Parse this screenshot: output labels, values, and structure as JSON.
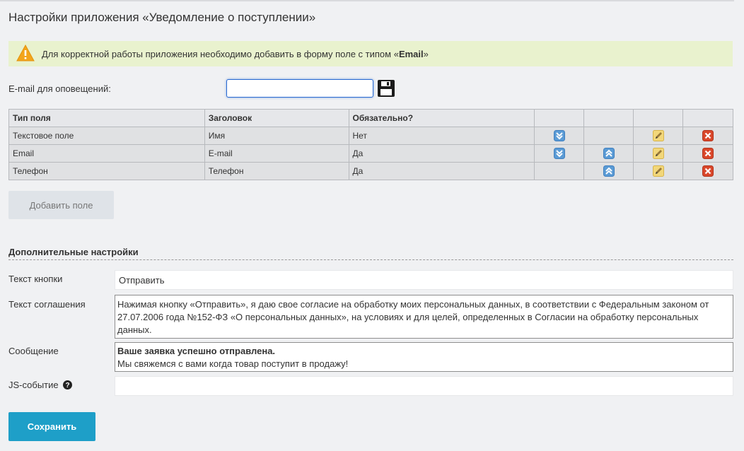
{
  "page": {
    "title": "Настройки приложения «Уведомление о поступлении»"
  },
  "warning": {
    "text": "Для корректной работы приложения необходимо добавить в форму поле с типом «",
    "bold": "Email",
    "suffix": "»"
  },
  "email_notify": {
    "label": "E-mail для оповещений:",
    "value": ""
  },
  "fields_table": {
    "headers": [
      "Тип поля",
      "Заголовок",
      "Обязательно?"
    ],
    "rows": [
      {
        "type": "Текстовое поле",
        "title": "Имя",
        "required": "Нет"
      },
      {
        "type": "Email",
        "title": "E-mail",
        "required": "Да"
      },
      {
        "type": "Телефон",
        "title": "Телефон",
        "required": "Да"
      }
    ]
  },
  "add_field_button": "Добавить поле",
  "additional": {
    "section_title": "Дополнительные настройки",
    "button_text_label": "Текст кнопки",
    "button_text_value": "Отправить",
    "agreement_label": "Текст соглашения",
    "agreement_value": "Нажимая кнопку «Отправить», я даю свое согласие на обработку моих персональных данных, в соответствии с Федеральным законом от 27.07.2006 года №152-ФЗ «О персональных данных», на условиях и для целей, определенных в Согласии на обработку персональных данных.",
    "message_label": "Сообщение",
    "message_bold": "Ваше заявка успешно отправлена.",
    "message_text": "Мы свяжемся с вами когда товар поступит в продажу!",
    "js_label": "JS-событие",
    "js_value": ""
  },
  "save_button": "Сохранить",
  "colors": {
    "accent": "#1e9fc8",
    "warning_bg": "#e9f2ce",
    "delete_icon": "#d9472b",
    "move_icon": "#5b9bd5"
  },
  "icons": {
    "warning": "warning-triangle-icon",
    "save": "floppy-disk-icon",
    "move_down": "chevron-double-down-icon",
    "move_up": "chevron-double-up-icon",
    "edit": "pencil-icon",
    "delete": "delete-x-icon",
    "help": "help-icon"
  }
}
